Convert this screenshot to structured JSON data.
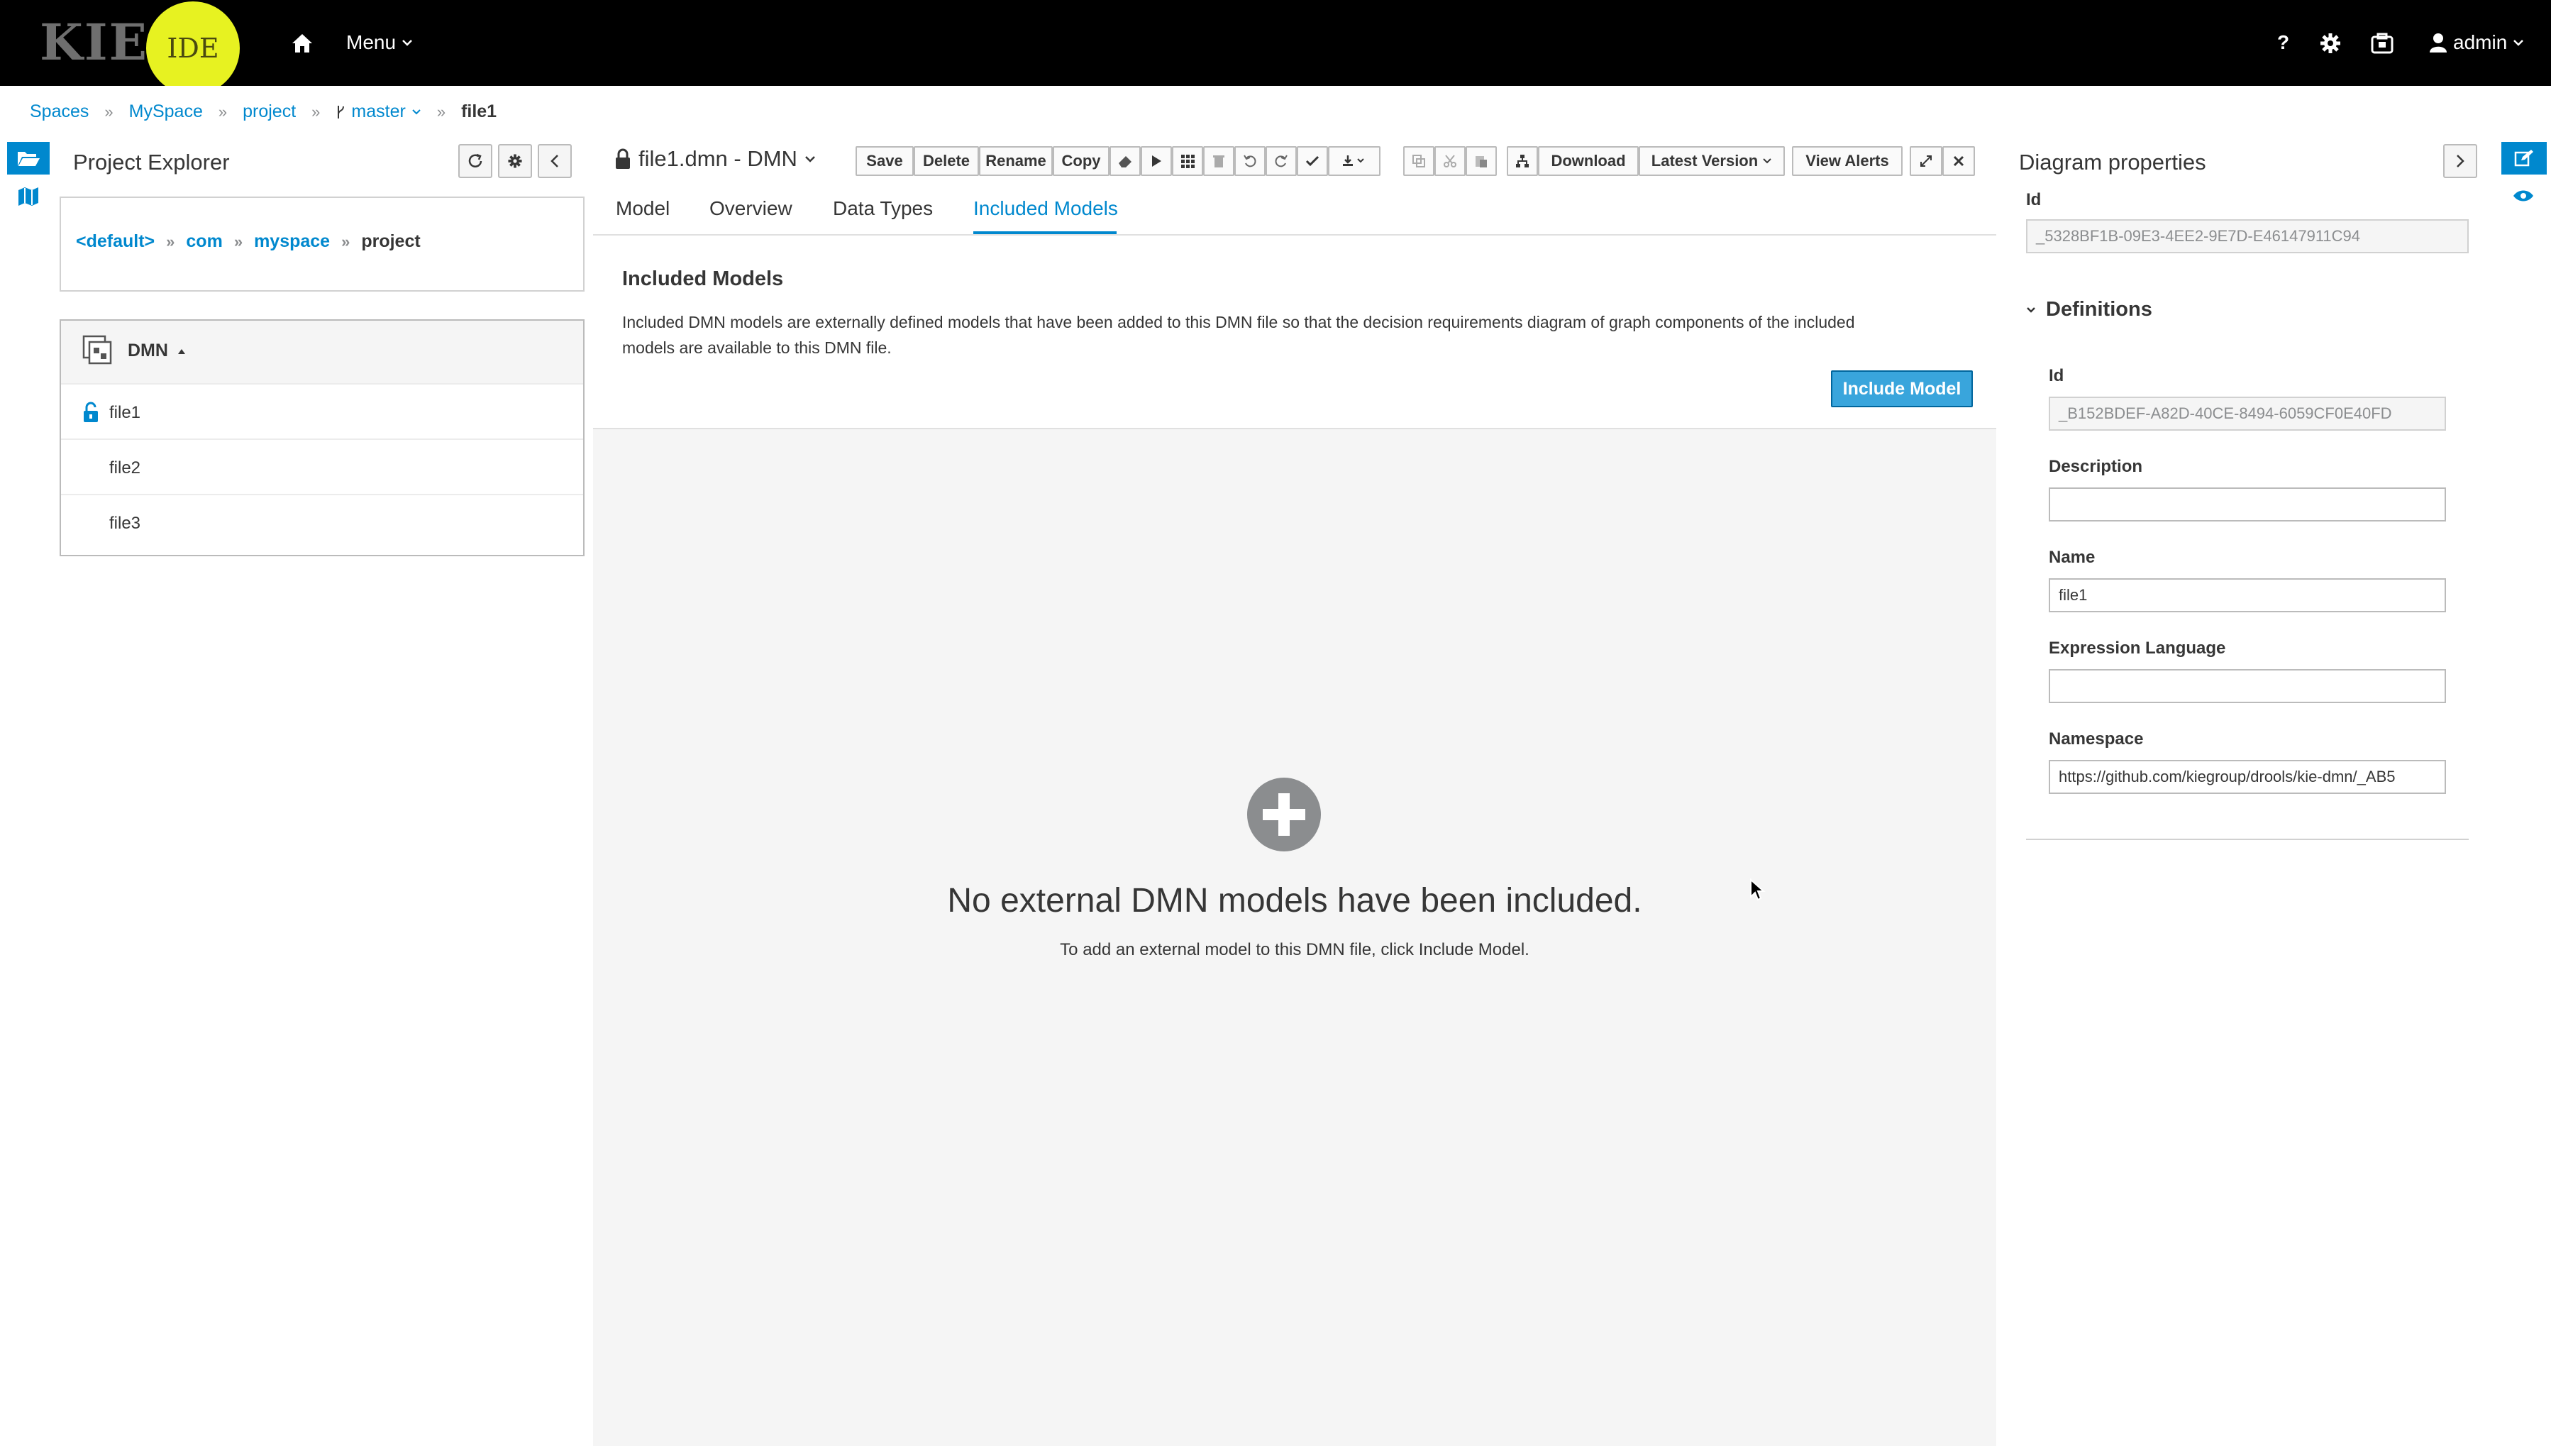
{
  "brand": {
    "kie": "KIE",
    "ide": "IDE"
  },
  "topnav": {
    "menu_label": "Menu",
    "user_label": "admin",
    "help_label": "?"
  },
  "breadcrumb": {
    "spaces": "Spaces",
    "myspace": "MySpace",
    "project": "project",
    "branch": "master",
    "file": "file1"
  },
  "explorer": {
    "title": "Project Explorer",
    "package_path": [
      "<default>",
      "com",
      "myspace",
      "project"
    ],
    "group_label": "DMN",
    "files": [
      "file1",
      "file2",
      "file3"
    ]
  },
  "editor": {
    "title": "file1.dmn - DMN",
    "toolbar": {
      "save": "Save",
      "delete": "Delete",
      "rename": "Rename",
      "copy": "Copy",
      "download": "Download",
      "latest_version": "Latest Version",
      "view_alerts": "View Alerts"
    },
    "tabs": [
      "Model",
      "Overview",
      "Data Types",
      "Included Models"
    ],
    "active_tab": "Included Models",
    "section_title": "Included Models",
    "section_desc_line1": "Included DMN models are externally defined models that have been added to this DMN file so that the decision requirements diagram of graph components of the included",
    "section_desc_line2": "models are available to this DMN file.",
    "include_button": "Include Model",
    "empty_title": "No external DMN models have been included.",
    "empty_hint": "To add an external model to this DMN file, click Include Model."
  },
  "properties": {
    "title": "Diagram properties",
    "top_id_label": "Id",
    "top_id_value": "_5328BF1B-09E3-4EE2-9E7D-E46147911C94",
    "section": "Definitions",
    "id_label": "Id",
    "id_value": "_B152BDEF-A82D-40CE-8494-6059CF0E40FD",
    "description_label": "Description",
    "description_value": "",
    "name_label": "Name",
    "name_value": "file1",
    "expr_lang_label": "Expression Language",
    "expr_lang_value": "",
    "namespace_label": "Namespace",
    "namespace_value": "https://github.com/kiegroup/drools/kie-dmn/_AB5"
  },
  "colors": {
    "accent": "#0088ce",
    "button_primary": "#39a5dc",
    "topbar": "#000000",
    "logo": "#e7f221"
  }
}
